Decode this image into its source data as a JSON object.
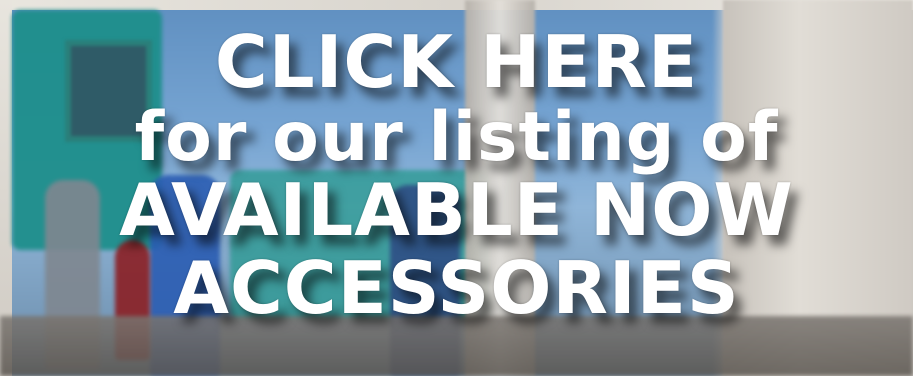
{
  "banner": {
    "line1": "CLICK HERE",
    "line2": "for our listing of",
    "line3": "AVAILABLE NOW",
    "line4": "ACCESSORIES"
  },
  "colors": {
    "text": "#ffffff",
    "shadow": "#000000"
  }
}
